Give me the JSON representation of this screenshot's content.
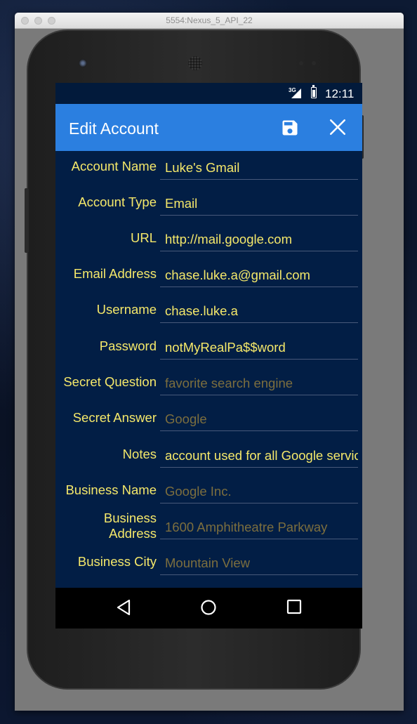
{
  "window": {
    "title": "5554:Nexus_5_API_22"
  },
  "status_bar": {
    "network": "3G",
    "time": "12:11"
  },
  "app_bar": {
    "title": "Edit Account",
    "save_icon": "save-icon",
    "close_icon": "close-icon"
  },
  "form": {
    "fields": [
      {
        "label": "Account Name",
        "value": "Luke's Gmail",
        "placeholder": ""
      },
      {
        "label": "Account Type",
        "value": "Email",
        "placeholder": ""
      },
      {
        "label": "URL",
        "value": "http://mail.google.com",
        "placeholder": ""
      },
      {
        "label": "Email Address",
        "value": "chase.luke.a@gmail.com",
        "placeholder": ""
      },
      {
        "label": "Username",
        "value": "chase.luke.a",
        "placeholder": ""
      },
      {
        "label": "Password",
        "value": "notMyRealPa$$word",
        "placeholder": ""
      },
      {
        "label": "Secret Question",
        "value": "",
        "placeholder": "favorite search engine"
      },
      {
        "label": "Secret Answer",
        "value": "",
        "placeholder": "Google"
      },
      {
        "label": "Notes",
        "value": "account used for all Google services",
        "placeholder": ""
      },
      {
        "label": "Business Name",
        "value": "",
        "placeholder": "Google Inc."
      },
      {
        "label_line1": "Business",
        "label_line2": "Address",
        "value": "",
        "placeholder": "1600 Amphitheatre Parkway"
      },
      {
        "label": "Business City",
        "value": "",
        "placeholder": "Mountain View"
      }
    ]
  },
  "nav_bar": {
    "back_icon": "back-icon",
    "home_icon": "home-icon",
    "recents_icon": "recents-icon"
  },
  "colors": {
    "app_bar": "#2b7fe0",
    "background": "#021e45",
    "label": "#f5e86a",
    "placeholder": "#7c6e3e"
  }
}
